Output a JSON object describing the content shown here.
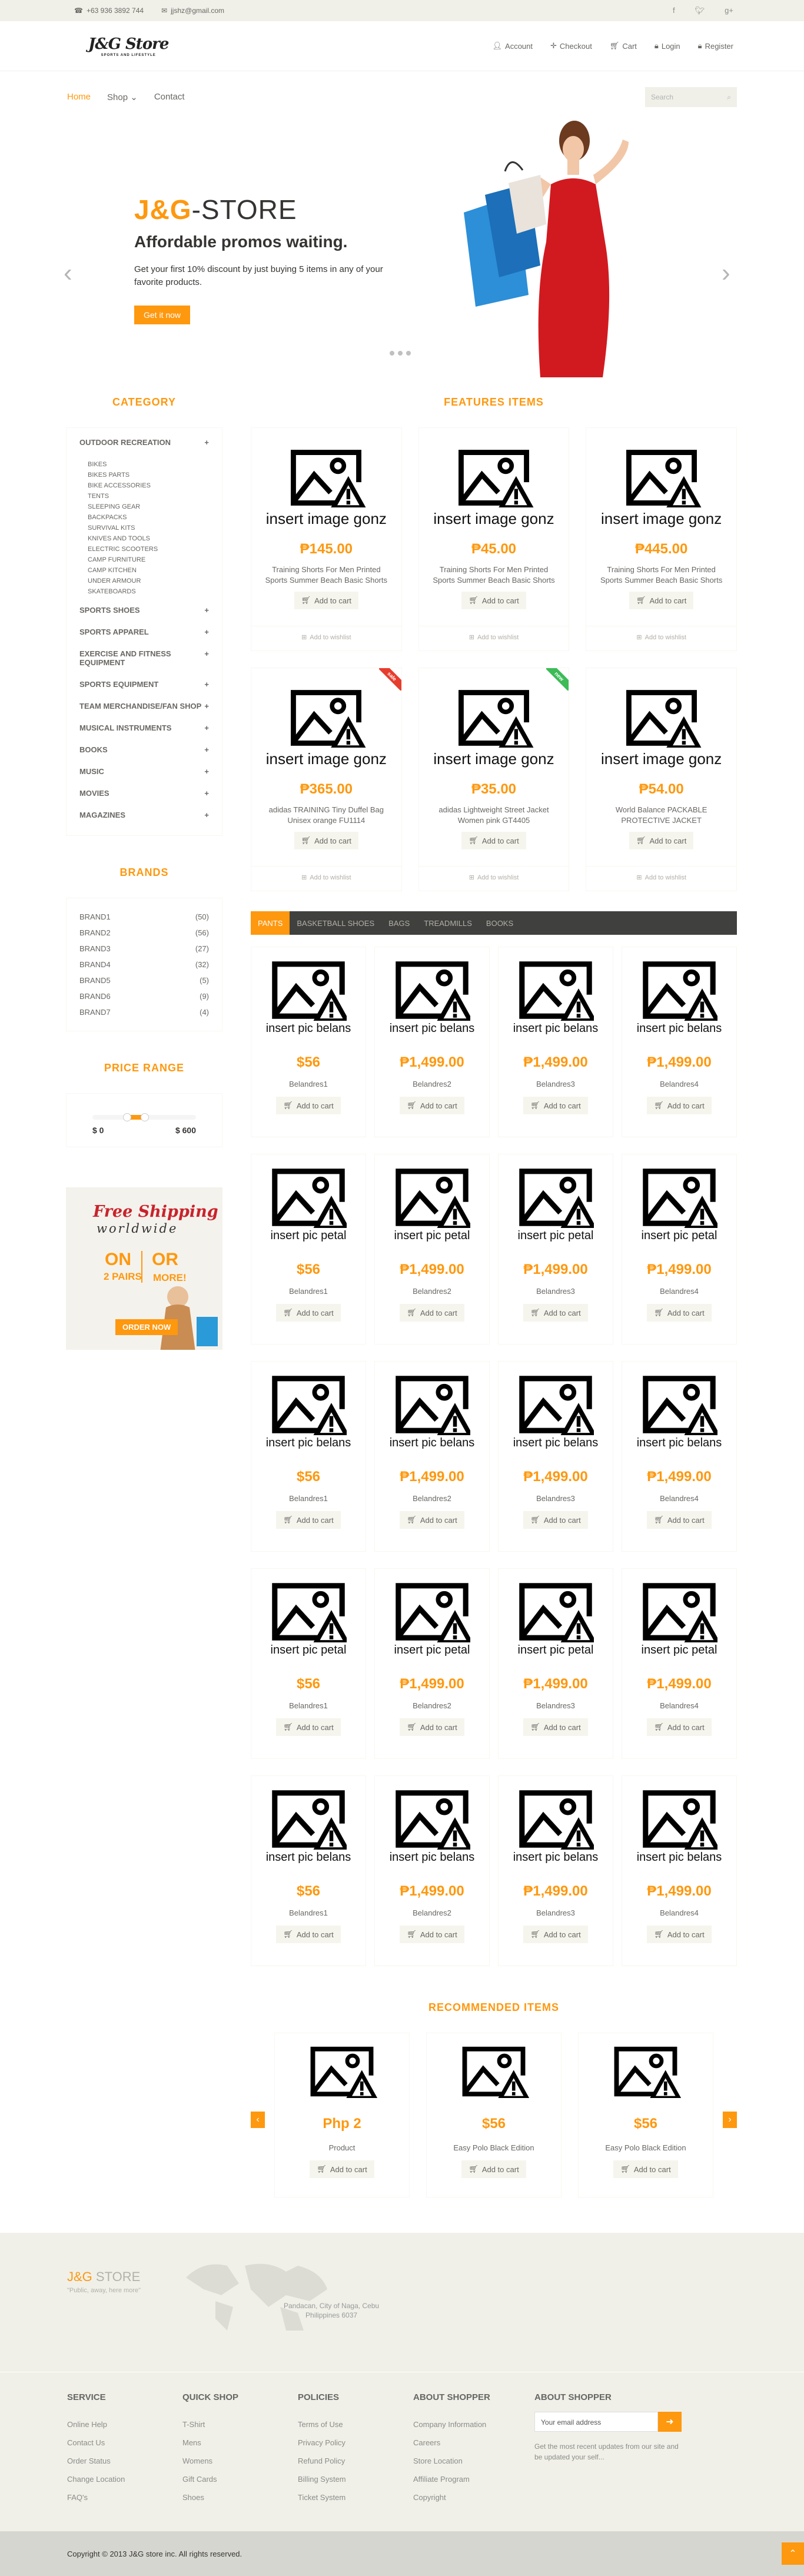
{
  "topbar": {
    "phone": "+63 936 3892 744",
    "email": "jjshz@gmail.com"
  },
  "header": {
    "logo_main": "J&G Store",
    "logo_sub": "SPORTS AND LIFESTYLE",
    "account": "Account",
    "checkout": "Checkout",
    "cart": "Cart",
    "login": "Login",
    "register": "Register"
  },
  "nav": {
    "home": "Home",
    "shop": "Shop",
    "contact": "Contact",
    "search_placeholder": "Search"
  },
  "slider": {
    "title_a": "J&G",
    "title_b": "-STORE",
    "subtitle": "Affordable promos waiting.",
    "text": "Get your first 10% discount by just buying 5 items in any of your favorite products.",
    "button": "Get it now"
  },
  "sidebar": {
    "category_title": "Category",
    "outdoor": "Outdoor Recreation",
    "outdoor_items": [
      "Bikes",
      "Bikes Parts",
      "Bike Accessories",
      "Tents",
      "Sleeping Gear",
      "Backpacks",
      "Survival Kits",
      "Knives and Tools",
      "Electric Scooters",
      "Camp Furniture",
      "Camp Kitchen",
      "Under Armour",
      "Skateboards"
    ],
    "categories": [
      "Sports Shoes",
      "Sports Apparel",
      "Exercise and Fitness Equipment",
      "Sports Equipment",
      "Team Merchandise/Fan Shop",
      "Musical Instruments",
      "Books",
      "Music",
      "Movies",
      "Magazines"
    ],
    "brands_title": "Brands",
    "brands": [
      {
        "name": "Brand1",
        "count": "(50)"
      },
      {
        "name": "Brand2",
        "count": "(56)"
      },
      {
        "name": "Brand3",
        "count": "(27)"
      },
      {
        "name": "Brand4",
        "count": "(32)"
      },
      {
        "name": "Brand5",
        "count": "(5)"
      },
      {
        "name": "Brand6",
        "count": "(9)"
      },
      {
        "name": "Brand7",
        "count": "(4)"
      }
    ],
    "price_title": "Price Range",
    "price_min": "$ 0",
    "price_max": "$ 600",
    "price_range": {
      "low": 200,
      "high": 300,
      "max": 600
    },
    "ship": {
      "free": "Free Shipping",
      "worldwide": "worldwide",
      "on": "ON",
      "pairs": "2 PAIRS",
      "or": "OR",
      "more": "MORE!",
      "order": "ORDER NOW"
    }
  },
  "features": {
    "title": "Features Items",
    "image_caption": "insert image gonz",
    "add_label": "Add to cart",
    "wish_label": "Add to wishlist",
    "items": [
      {
        "price": "₱145.00",
        "name": "Training Shorts For Men Printed Sports Summer Beach Basic Shorts",
        "badge": ""
      },
      {
        "price": "₱45.00",
        "name": "Training Shorts For Men Printed Sports Summer Beach Basic Shorts",
        "badge": ""
      },
      {
        "price": "₱445.00",
        "name": "Training Shorts For Men Printed Sports Summer Beach Basic Shorts",
        "badge": ""
      },
      {
        "price": "₱365.00",
        "name": "adidas TRAINING Tiny Duffel Bag Unisex orange FU1114",
        "badge": "sale",
        "badge_color": "#e63d2f"
      },
      {
        "price": "₱35.00",
        "name": "adidas Lightweight Street Jacket Women pink GT4405",
        "badge": "new",
        "badge_color": "#3cbb57"
      },
      {
        "price": "₱54.00",
        "name": "World Balance PACKABLE PROTECTIVE JACKET",
        "badge": ""
      }
    ]
  },
  "tabs": [
    "Pants",
    "Basketball Shoes",
    "Bags",
    "Treadmills",
    "Books"
  ],
  "tab_grid": {
    "caption_a": "insert pic belans",
    "caption_b": "insert pic petal",
    "prices": [
      "$56",
      "₱1,499.00",
      "₱1,499.00",
      "₱1,499.00"
    ],
    "names": [
      "Belandres1",
      "Belandres2",
      "Belandres3",
      "Belandres4"
    ]
  },
  "recommended": {
    "title": "Recommended Items",
    "items": [
      {
        "price": "Php 2",
        "name": "Product"
      },
      {
        "price": "$56",
        "name": "Easy Polo Black Edition"
      },
      {
        "price": "$56",
        "name": "Easy Polo Black Edition"
      }
    ]
  },
  "footer": {
    "logo_a": "J&G",
    "logo_b": " STORE",
    "tagline": "\"Public, away, here more\"",
    "address": "Pandacan, City of Naga, Cebu\nPhilippines 6037",
    "columns": [
      {
        "title": "Service",
        "items": [
          "Online Help",
          "Contact Us",
          "Order Status",
          "Change Location",
          "FAQ's"
        ]
      },
      {
        "title": "Quick Shop",
        "items": [
          "T-Shirt",
          "Mens",
          "Womens",
          "Gift Cards",
          "Shoes"
        ]
      },
      {
        "title": "Policies",
        "items": [
          "Terms of Use",
          "Privacy Policy",
          "Refund Policy",
          "Billing System",
          "Ticket System"
        ]
      },
      {
        "title": "About Shopper",
        "items": [
          "Company Information",
          "Careers",
          "Store Location",
          "Affiliate Program",
          "Copyright"
        ]
      }
    ],
    "subscribe_title": "About Shopper",
    "subscribe_placeholder": "Your email address",
    "subscribe_text": "Get the most recent updates from our site and be updated your self...",
    "copyright": "Copyright © 2013 J&G store inc. All rights reserved."
  },
  "colors": {
    "accent": "#fe980f",
    "dark": "#363432"
  }
}
